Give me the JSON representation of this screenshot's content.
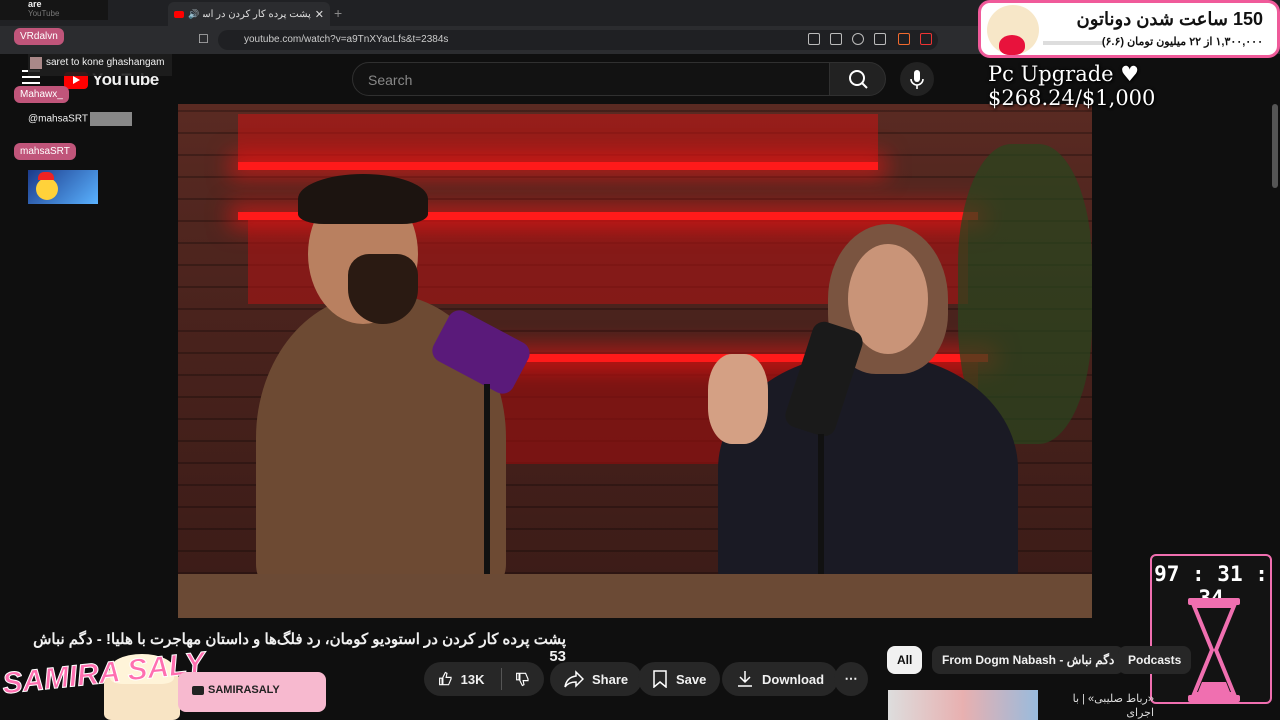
{
  "browser": {
    "tab_title": "پشت پرده کار کردن در استودیو",
    "new_tab": "+",
    "url": "youtube.com/watch?v=a9TnXYacLfs&t=2384s"
  },
  "youtube": {
    "logo": "YouTube",
    "search_placeholder": "Search",
    "video_title": "پشت پرده کار کردن در استودیو کومان، رد فلگ‌ها و داستان مهاجرت با هلیا! - دگم نباش 53",
    "likes": "13K",
    "share": "Share",
    "save": "Save",
    "download": "Download",
    "more": "⋯",
    "filter_chips": [
      "All",
      "From Dogm Nabash - دگم نباش",
      "Podcasts"
    ],
    "rec_title": "«رباط صلیبی» | با اجرای"
  },
  "overlay": {
    "top_left_title": "are",
    "top_left_sub": "YouTube",
    "chat": {
      "user1": "VRdalvn",
      "msg1": "saret to kone ghashangam",
      "user2": "Mahawx_",
      "msg2": "@mahsaSRT",
      "user3": "mahsaSRT"
    },
    "donation": {
      "title": "150 ساعت شدن دوناتون",
      "subtitle": "۱,۳۰۰,۰۰۰ از ۲۲ میلیون تومان (۶.۶)"
    },
    "pc_upgrade": "Pc Upgrade ♥ $268.24/$1,000",
    "timer": "97 : 31 : 34",
    "brand": "SAMIRA SALY",
    "handle": "SAMIRASALY"
  },
  "colors": {
    "youtube_red": "#ff0000",
    "overlay_pink": "#f05a9a",
    "shelf_red": "#ff1a1a"
  }
}
